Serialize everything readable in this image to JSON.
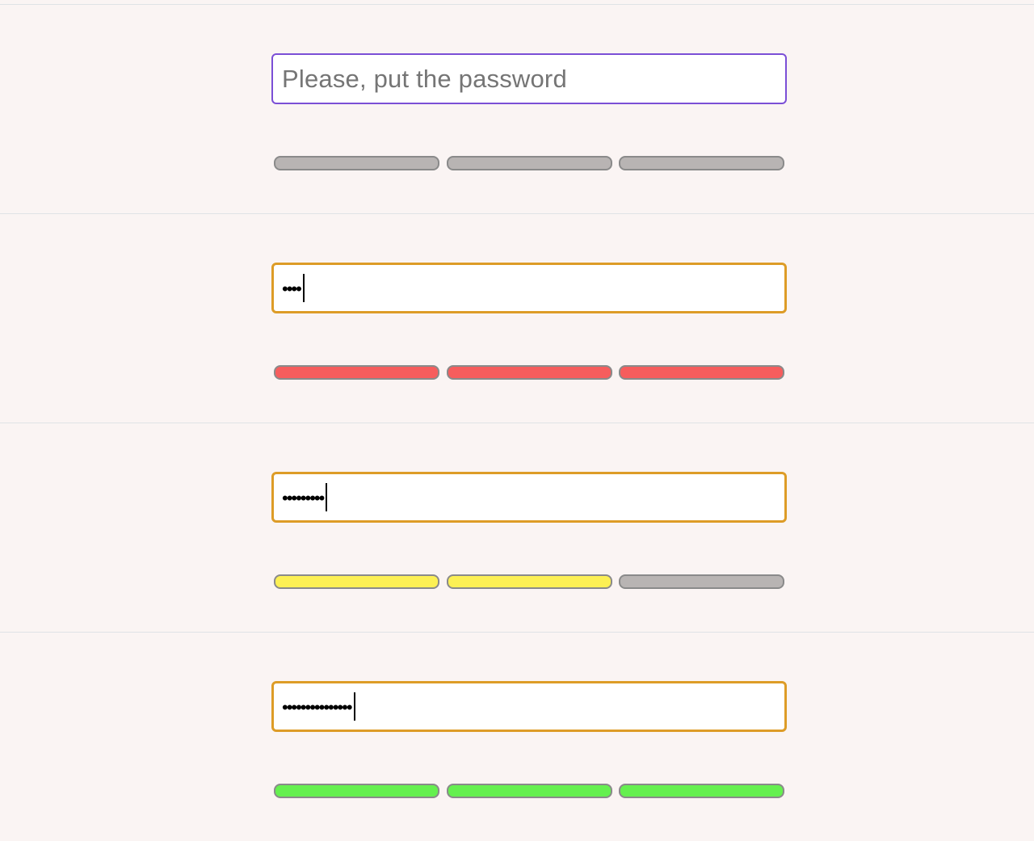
{
  "colors": {
    "background": "#faf4f3",
    "focus_border_empty": "#7b4fd6",
    "focus_border_filled": "#dd9c27",
    "bar_inactive": "#b8b4b3",
    "bar_weak": "#f65d5d",
    "bar_medium": "#fcf054",
    "bar_strong": "#65f04f"
  },
  "examples": [
    {
      "placeholder": "Please, put the password",
      "masked_value": "",
      "strength": "none",
      "bars": [
        "gray",
        "gray",
        "gray"
      ]
    },
    {
      "placeholder": "Please, put the password",
      "masked_value": "••••",
      "strength": "weak",
      "bars": [
        "red",
        "red",
        "red"
      ]
    },
    {
      "placeholder": "Please, put the password",
      "masked_value": "•••••••••",
      "strength": "medium",
      "bars": [
        "yellow",
        "yellow",
        "gray"
      ]
    },
    {
      "placeholder": "Please, put the password",
      "masked_value": "•••••••••••••••",
      "strength": "strong",
      "bars": [
        "green",
        "green",
        "green"
      ]
    }
  ]
}
